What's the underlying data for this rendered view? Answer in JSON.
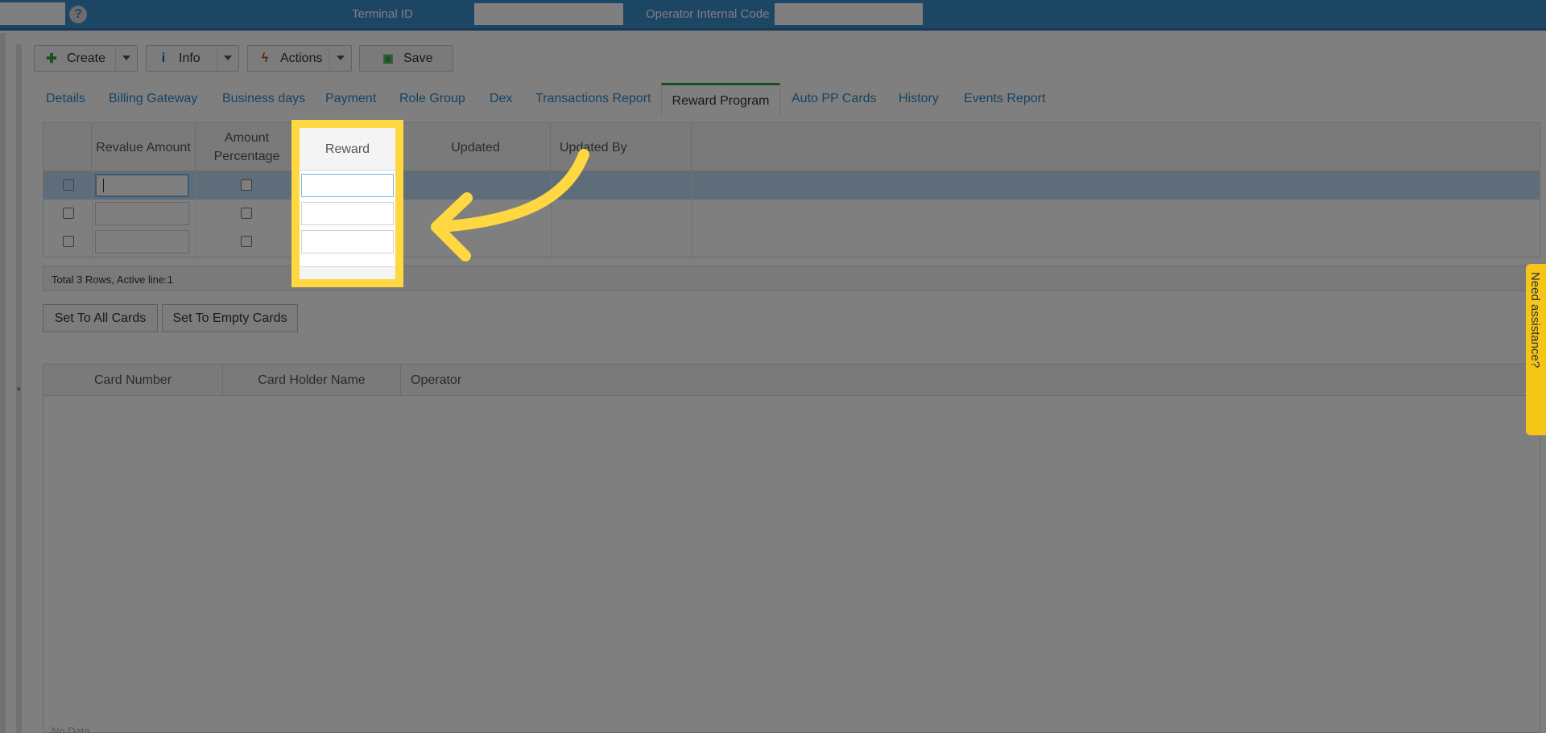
{
  "header": {
    "terminal_id_label": "Terminal ID",
    "operator_code_label": "Operator Internal Code",
    "help_icon": "?"
  },
  "toolbar": {
    "create_label": "Create",
    "info_label": "Info",
    "actions_label": "Actions",
    "save_label": "Save"
  },
  "tabs": [
    "Details",
    "Billing Gateway",
    "Business days",
    "Payment",
    "Role Group",
    "Dex",
    "Transactions Report",
    "Reward Program",
    "Auto PP Cards",
    "History",
    "Events Report"
  ],
  "active_tab": "Reward Program",
  "reward_grid": {
    "columns": {
      "revalue_amount": "Revalue Amount",
      "amount_percentage": "Amount Percentage",
      "reward": "Reward",
      "updated": "Updated",
      "updated_by": "Updated By"
    },
    "footer": "Total 3 Rows, Active line:1"
  },
  "buttons": {
    "set_all": "Set To All Cards",
    "set_empty": "Set To Empty Cards"
  },
  "cards_grid": {
    "columns": {
      "card_number": "Card Number",
      "card_holder_name": "Card Holder Name",
      "operator": "Operator"
    },
    "empty_text": "No Data"
  },
  "assist_tab": "Need assistance?",
  "colors": {
    "header": "#3a8ac9",
    "active_tab_border": "#2aa03a",
    "highlight": "#ffd740",
    "selected_row": "#bcdaf2"
  }
}
